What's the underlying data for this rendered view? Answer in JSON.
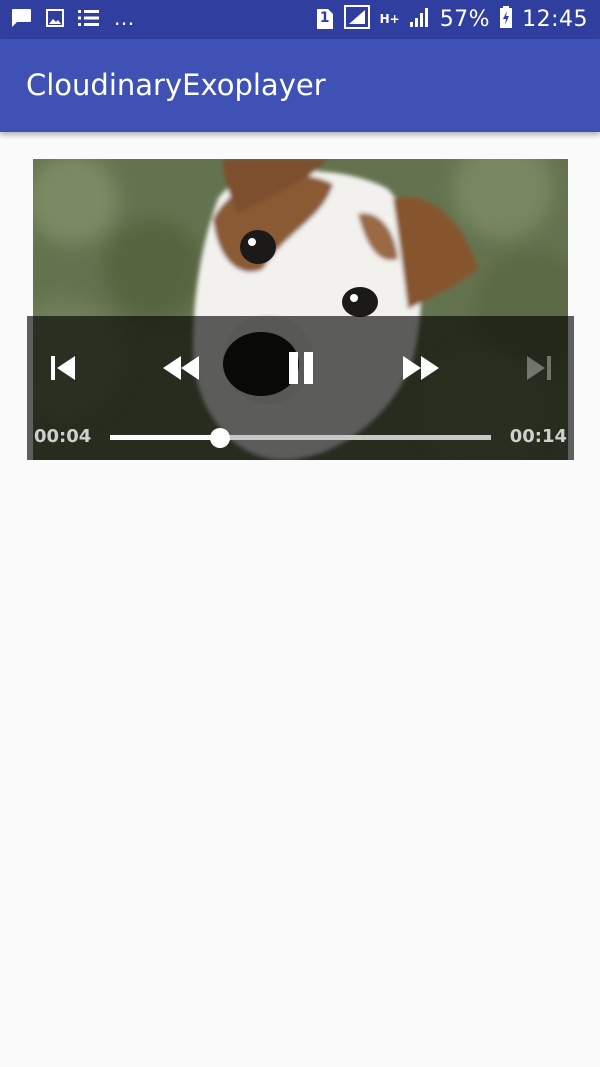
{
  "status_bar": {
    "notifications": [
      "chat-icon",
      "image-icon",
      "list-icon"
    ],
    "more": "...",
    "sim_badge": "1",
    "network_type": "H+",
    "battery_percent": "57%",
    "time": "12:45"
  },
  "app_bar": {
    "title": "CloudinaryExoplayer"
  },
  "player": {
    "controls": [
      "previous-icon",
      "rewind-icon",
      "pause-icon",
      "fast-forward-icon",
      "next-icon"
    ],
    "next_enabled": false,
    "position": "00:04",
    "duration": "00:14",
    "progress_fraction": 0.29
  },
  "colors": {
    "status_bar": "#303f9f",
    "app_bar": "#3f51b5",
    "background": "#fafafa"
  }
}
